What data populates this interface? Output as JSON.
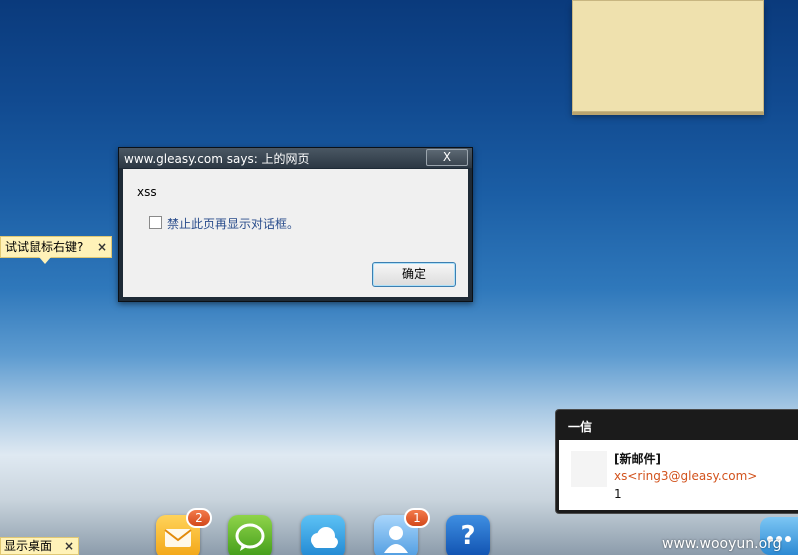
{
  "dialog": {
    "title": "www.gleasy.com says: 上的网页",
    "close_label": "X",
    "message": "xss",
    "checkbox_label": "禁止此页再显示对话框。",
    "ok_label": "确定"
  },
  "tips": {
    "right_click": "试试鼠标右键?",
    "show_desktop": "显示桌面",
    "close_label": "×"
  },
  "notification": {
    "title": "一信",
    "heading": "[新邮件]",
    "sender": "xs<ring3@gleasy.com>",
    "subject": "1"
  },
  "dock": {
    "mail_badge": "2",
    "contact_badge": "1",
    "icons": [
      "mail-icon",
      "chat-icon",
      "cloud-icon",
      "contact-icon",
      "help-icon",
      "more-icon"
    ]
  },
  "watermark": "www.wooyun.org",
  "colors": {
    "sender_link": "#d2521c",
    "badge": "#d2481a",
    "tooltip": "#fff2b8"
  }
}
